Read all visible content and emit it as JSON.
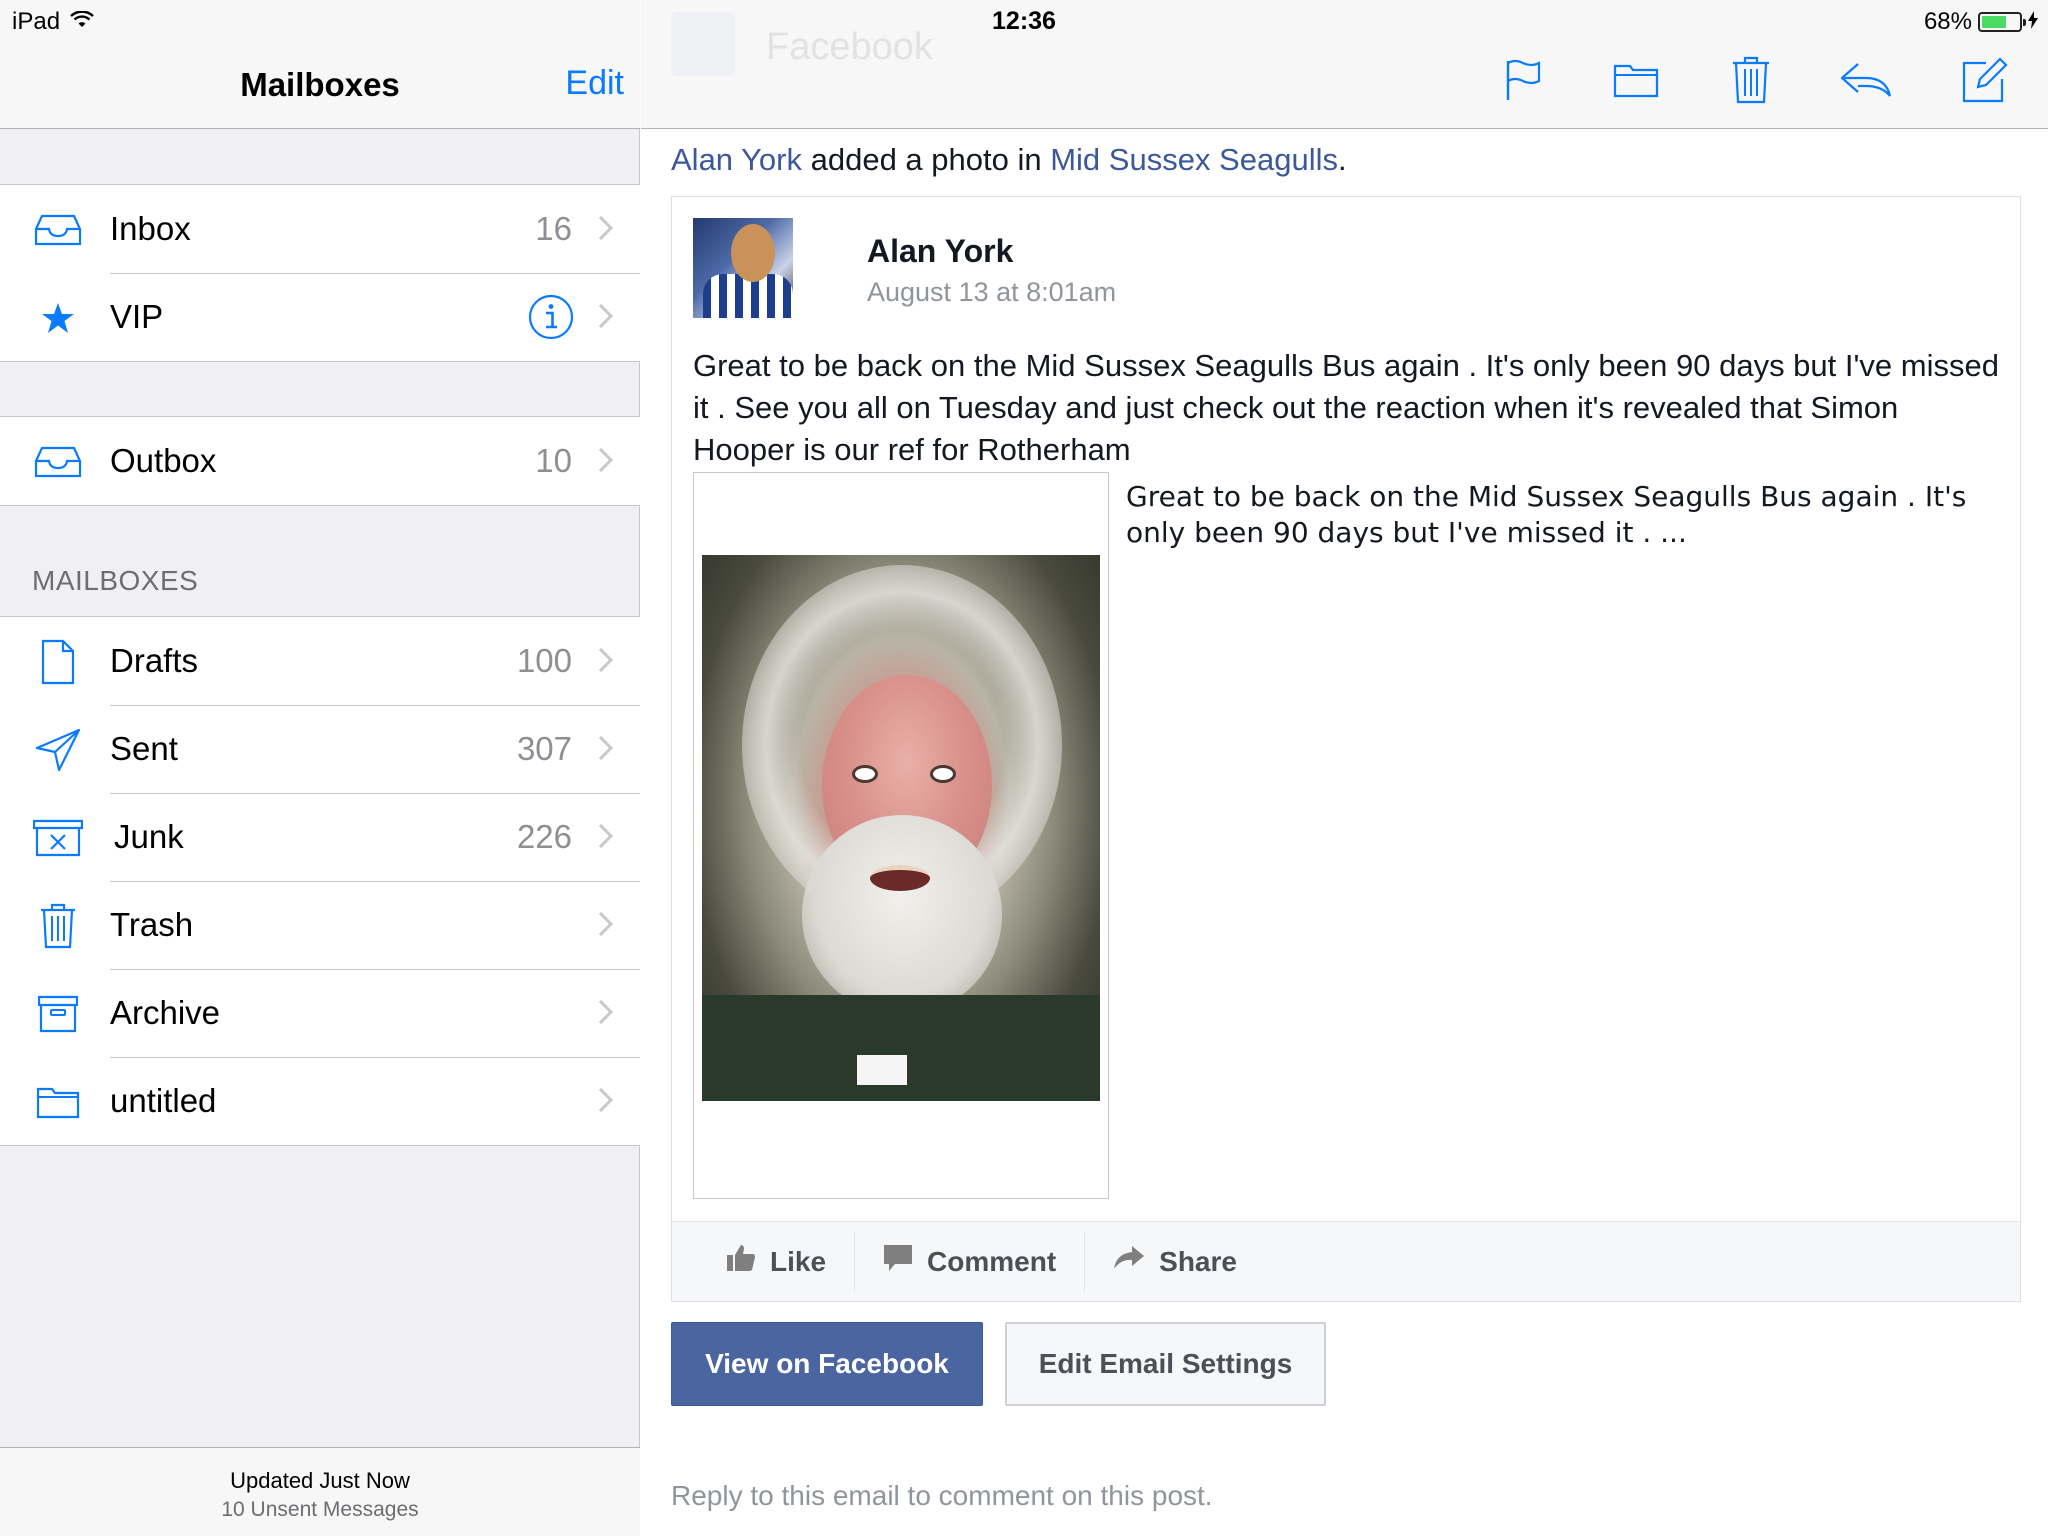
{
  "status_bar": {
    "device": "iPad",
    "time": "12:36",
    "battery_percent": "68%",
    "battery_level": 0.68
  },
  "sidebar": {
    "title": "Mailboxes",
    "edit_label": "Edit",
    "top_group": [
      {
        "label": "Inbox",
        "count": "16",
        "icon": "inbox-icon"
      },
      {
        "label": "VIP",
        "count": "",
        "icon": "star-icon"
      }
    ],
    "outbox": {
      "label": "Outbox",
      "count": "10",
      "icon": "outbox-icon"
    },
    "section_title": "MAILBOXES",
    "mailboxes": [
      {
        "label": "Drafts",
        "count": "100",
        "icon": "drafts-icon"
      },
      {
        "label": "Sent",
        "count": "307",
        "icon": "sent-icon"
      },
      {
        "label": "Junk",
        "count": "226",
        "icon": "junk-icon"
      },
      {
        "label": "Trash",
        "count": "",
        "icon": "trash-icon"
      },
      {
        "label": "Archive",
        "count": "",
        "icon": "archive-icon"
      },
      {
        "label": "untitled",
        "count": "",
        "icon": "folder-icon"
      }
    ],
    "footer": {
      "updated": "Updated Just Now",
      "unsent": "10 Unsent Messages"
    }
  },
  "toolbar": {
    "ghost_sender": "Facebook",
    "icons": [
      "flag-icon",
      "move-folder-icon",
      "trash-icon",
      "reply-icon",
      "compose-icon"
    ]
  },
  "email": {
    "note": {
      "actor": "Alan York",
      "middle": " added a photo in ",
      "group": "Mid Sussex Seagulls",
      "end": "."
    },
    "post": {
      "author": "Alan York",
      "date": "August 13 at 8:01am",
      "text": "Great to be back on the Mid Sussex Seagulls Bus again . It's only been 90 days but I've missed it . See you all on Tuesday and just check out the reaction when it's revealed that Simon Hooper is our ref for Rotherham",
      "caption": "Great to be back on the Mid Sussex Seagulls Bus again . It's only been 90 days but I've missed it . ...",
      "actions": {
        "like": "Like",
        "comment": "Comment",
        "share": "Share"
      }
    },
    "buttons": {
      "view": "View on Facebook",
      "settings": "Edit Email Settings"
    },
    "footer": "Reply to this email to comment on this post."
  },
  "colors": {
    "ios_blue": "#0a7aff",
    "facebook_blue": "#3b5998",
    "battery_green": "#4cd964"
  }
}
